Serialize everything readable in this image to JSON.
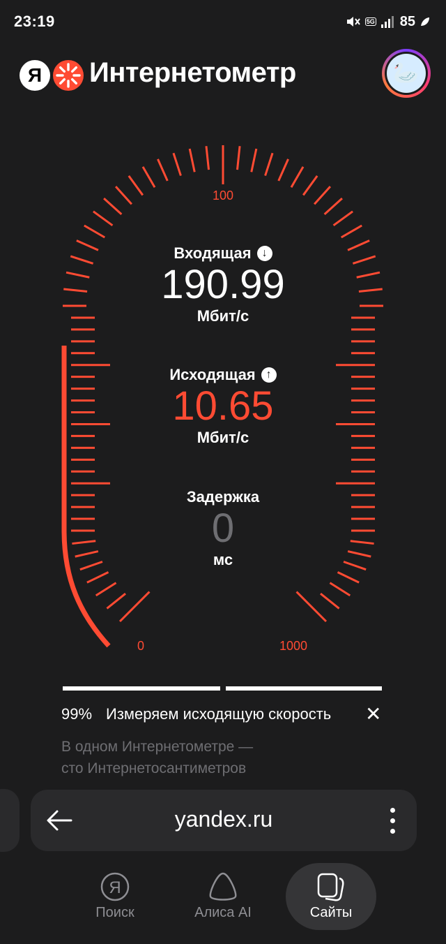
{
  "status_bar": {
    "time": "23:19",
    "network": "5G",
    "battery": "85"
  },
  "header": {
    "logo_letter": "Я",
    "title": "Интернетометр"
  },
  "gauge": {
    "ticks": [
      "100",
      "0",
      "1000"
    ],
    "accent_color": "#ff4b33",
    "progress_fraction": 0.19
  },
  "readouts": {
    "download": {
      "label": "Входящая",
      "value": "190.99",
      "unit": "Мбит/с"
    },
    "upload": {
      "label": "Исходящая",
      "value": "10.65",
      "unit": "Мбит/с"
    },
    "latency": {
      "label": "Задержка",
      "value": "0",
      "unit": "мс"
    }
  },
  "progress": {
    "percent_label": "99%",
    "text": "Измеряем исходящую скорость",
    "close": "✕"
  },
  "tagline": {
    "line1": "В одном Интернетометре —",
    "line2": "сто Интернетосантиметров"
  },
  "urlbar": {
    "url": "yandex.ru"
  },
  "bottom_nav": {
    "search": "Поиск",
    "alice": "Алиса AI",
    "sites": "Сайты"
  }
}
